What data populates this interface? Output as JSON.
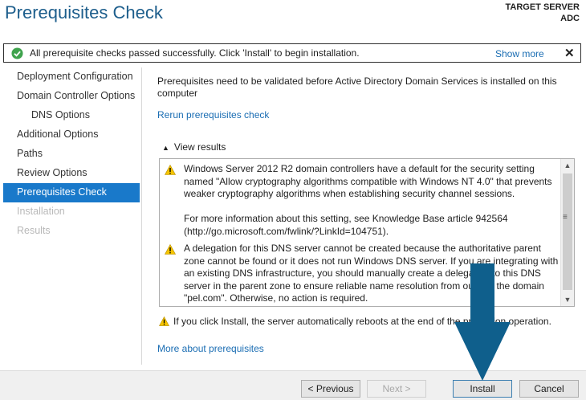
{
  "header": {
    "title": "Prerequisites Check",
    "target_label": "TARGET SERVER",
    "target_name": "ADC"
  },
  "notice": {
    "message": "All prerequisite checks passed successfully.  Click 'Install' to begin installation.",
    "show_more": "Show more",
    "close": "✕"
  },
  "nav": {
    "items": [
      {
        "label": "Deployment Configuration"
      },
      {
        "label": "Domain Controller Options"
      },
      {
        "label": "DNS Options"
      },
      {
        "label": "Additional Options"
      },
      {
        "label": "Paths"
      },
      {
        "label": "Review Options"
      },
      {
        "label": "Prerequisites Check"
      },
      {
        "label": "Installation"
      },
      {
        "label": "Results"
      }
    ]
  },
  "main": {
    "intro": "Prerequisites need to be validated before Active Directory Domain Services is installed on this computer",
    "rerun": "Rerun prerequisites check",
    "view_results": "View results",
    "results": [
      {
        "text": "Windows Server 2012 R2 domain controllers have a default for the security setting named \"Allow cryptography algorithms compatible with Windows NT 4.0\" that prevents weaker cryptography algorithms when establishing security channel sessions.",
        "extra": "For more information about this setting, see Knowledge Base article 942564 (http://go.microsoft.com/fwlink/?LinkId=104751)."
      },
      {
        "text": "A delegation for this DNS server cannot be created because the authoritative parent zone cannot be found or it does not run Windows DNS server. If you are integrating with an existing DNS infrastructure, you should manually create a delegation to this DNS server in the parent zone to ensure reliable name resolution from outside the domain \"pel.com\". Otherwise, no action is required."
      }
    ],
    "reboot_warning": "If you click Install, the server automatically reboots at the end of the promotion operation.",
    "more_about": "More about prerequisites"
  },
  "footer": {
    "previous": "< Previous",
    "next": "Next >",
    "install": "Install",
    "cancel": "Cancel"
  },
  "colors": {
    "title": "#1d5e8c",
    "link": "#1a6db3",
    "nav_active": "#1979ca",
    "arrow": "#0f5f8c",
    "ok": "#3fa34d",
    "warning": "#f5c400"
  }
}
